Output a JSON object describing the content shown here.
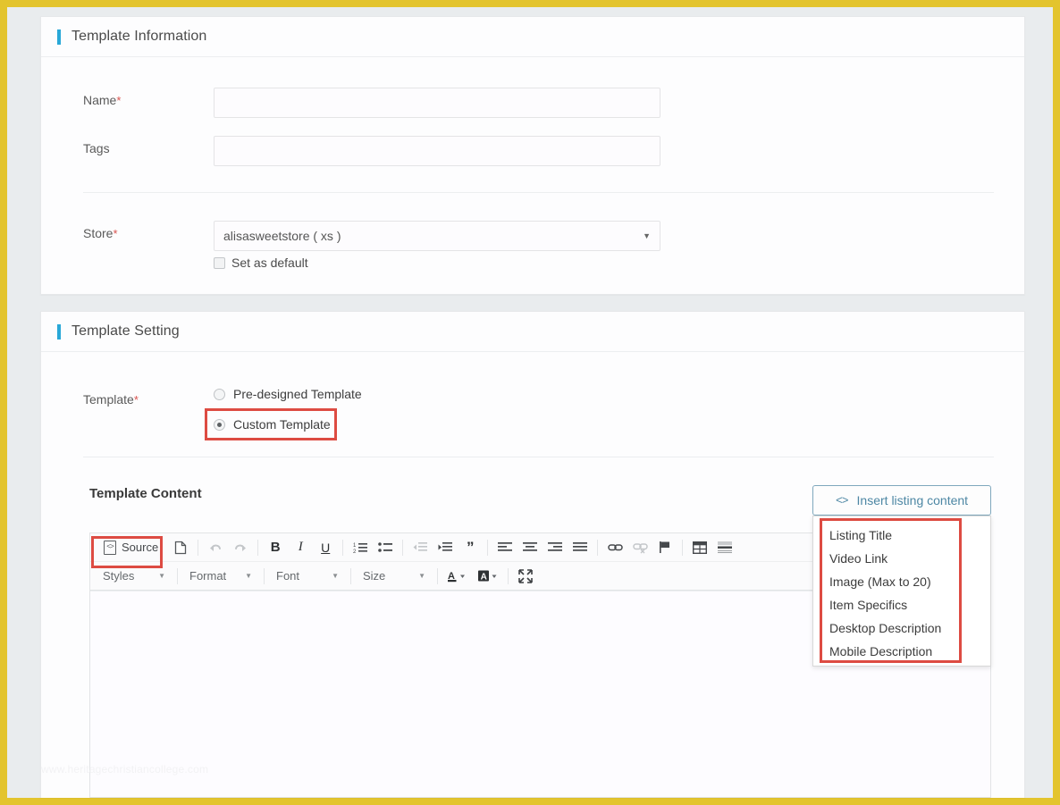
{
  "theme": {
    "accent_blue": "#29a8d8",
    "annotation_red": "#dd4b42",
    "button_teal": "#4d87a4",
    "outer_border": "#e3c42e"
  },
  "template_information": {
    "section_title": "Template Information",
    "name": {
      "label": "Name",
      "required_marker": "*",
      "value": "",
      "placeholder": ""
    },
    "tags": {
      "label": "Tags",
      "value": "",
      "placeholder": ""
    },
    "store": {
      "label": "Store",
      "required_marker": "*",
      "selected": "alisasweetstore ( xs )",
      "caret": "▼"
    },
    "set_as_default": {
      "label": "Set as default",
      "checked": false
    }
  },
  "template_setting": {
    "section_title": "Template Setting",
    "template": {
      "label": "Template",
      "required_marker": "*",
      "options": [
        {
          "label": "Pre-designed Template",
          "selected": false
        },
        {
          "label": "Custom Template",
          "selected": true
        }
      ]
    },
    "template_content": {
      "label": "Template Content"
    },
    "insert_listing_content": {
      "label": "Insert listing content",
      "icon": "code-brackets-icon",
      "icon_glyph": "<>",
      "menu_items": [
        "Listing Title",
        "Video Link",
        "Image (Max to 20)",
        "Item Specifics",
        "Desktop Description",
        "Mobile Description"
      ]
    },
    "editor": {
      "source_button": {
        "label": "Source",
        "icon": "source-code-document-icon"
      },
      "toolbar_row1": [
        {
          "name": "new-page-icon",
          "title": "New Page",
          "glyph": "doc",
          "dim": false
        },
        {
          "name": "separator",
          "title": "",
          "glyph": "sep",
          "dim": false
        },
        {
          "name": "undo-icon",
          "title": "Undo",
          "glyph": "undo",
          "dim": true
        },
        {
          "name": "redo-icon",
          "title": "Redo",
          "glyph": "redo",
          "dim": true
        },
        {
          "name": "separator",
          "title": "",
          "glyph": "sep",
          "dim": false
        },
        {
          "name": "bold-icon",
          "title": "Bold",
          "glyph": "B",
          "dim": false
        },
        {
          "name": "italic-icon",
          "title": "Italic",
          "glyph": "I",
          "dim": false
        },
        {
          "name": "underline-icon",
          "title": "Underline",
          "glyph": "U",
          "dim": false
        },
        {
          "name": "separator",
          "title": "",
          "glyph": "sep",
          "dim": false
        },
        {
          "name": "numbered-list-icon",
          "title": "Numbered List",
          "glyph": "ol",
          "dim": false
        },
        {
          "name": "bulleted-list-icon",
          "title": "Bulleted List",
          "glyph": "ul",
          "dim": false
        },
        {
          "name": "separator",
          "title": "",
          "glyph": "sep",
          "dim": false
        },
        {
          "name": "decrease-indent-icon",
          "title": "Decrease Indent",
          "glyph": "outdent",
          "dim": true
        },
        {
          "name": "increase-indent-icon",
          "title": "Increase Indent",
          "glyph": "indent",
          "dim": false
        },
        {
          "name": "blockquote-icon",
          "title": "Block Quote",
          "glyph": "quote",
          "dim": false
        },
        {
          "name": "separator",
          "title": "",
          "glyph": "sep",
          "dim": false
        },
        {
          "name": "align-left-icon",
          "title": "Align Left",
          "glyph": "al",
          "dim": false
        },
        {
          "name": "align-center-icon",
          "title": "Center",
          "glyph": "ac",
          "dim": false
        },
        {
          "name": "align-right-icon",
          "title": "Align Right",
          "glyph": "ar",
          "dim": false
        },
        {
          "name": "justify-icon",
          "title": "Justify",
          "glyph": "aj",
          "dim": false
        },
        {
          "name": "separator",
          "title": "",
          "glyph": "sep",
          "dim": false
        },
        {
          "name": "link-icon",
          "title": "Link",
          "glyph": "link",
          "dim": false
        },
        {
          "name": "unlink-icon",
          "title": "Unlink",
          "glyph": "unlink",
          "dim": true
        },
        {
          "name": "anchor-flag-icon",
          "title": "Anchor",
          "glyph": "flag",
          "dim": false
        },
        {
          "name": "separator",
          "title": "",
          "glyph": "sep",
          "dim": false
        },
        {
          "name": "table-icon",
          "title": "Table",
          "glyph": "table",
          "dim": false
        },
        {
          "name": "horizontal-rule-icon",
          "title": "Horizontal Line",
          "glyph": "hr",
          "dim": false
        }
      ],
      "toolbar_row2": {
        "combos": [
          {
            "name": "styles-select",
            "label": "Styles",
            "caret": "▼"
          },
          {
            "name": "format-select",
            "label": "Format",
            "caret": "▼"
          },
          {
            "name": "font-select",
            "label": "Font",
            "caret": "▼"
          },
          {
            "name": "size-select",
            "label": "Size",
            "caret": "▼"
          }
        ],
        "buttons": [
          {
            "name": "text-color-icon",
            "title": "Text Color",
            "glyph": "tcolor"
          },
          {
            "name": "bg-color-icon",
            "title": "Background Color",
            "glyph": "bcolor"
          },
          {
            "name": "maximize-icon",
            "title": "Maximize",
            "glyph": "max"
          }
        ]
      },
      "content": ""
    }
  },
  "watermark": {
    "text": "www.heritagechristiancollege.com"
  }
}
